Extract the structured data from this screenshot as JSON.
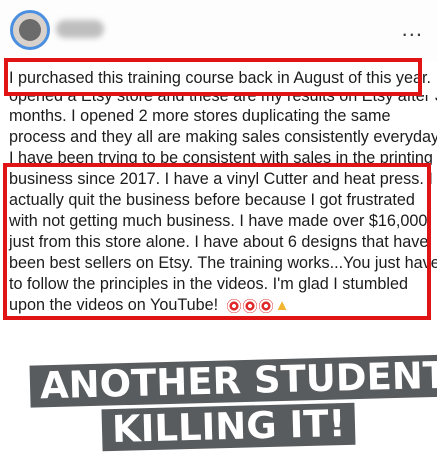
{
  "post": {
    "more_label": "...",
    "lines": [
      "I purchased this training course back in August of this year.",
      "opened a Etsy store and these are my results on Etsy after 3",
      "months. I opened 2 more stores duplicating the same",
      "process and they all are making sales consistently everyday.",
      "I have been trying to be consistent with sales in the printing",
      "business since 2017. I have a vinyl Cutter and heat press. I",
      "actually quit the business before because I got frustrated",
      "with not getting much business. I have made over $16,000",
      "just from this store alone. I have about 6 designs that have",
      "been best sellers on Etsy. The training works...You just have",
      "to follow the principles in the videos. I'm glad I stumbled",
      "upon the videos on YouTube!"
    ]
  },
  "overlay": {
    "line1": "ANOTHER STUDENT",
    "line2": "KILLING IT!"
  },
  "colors": {
    "highlight": "#e01414",
    "banner": "#595c5f",
    "avatar_ring": "#4b8fe0"
  },
  "icons": [
    "avatar-image",
    "more-options-icon",
    "target-emoji",
    "thumbs-up-emoji"
  ]
}
